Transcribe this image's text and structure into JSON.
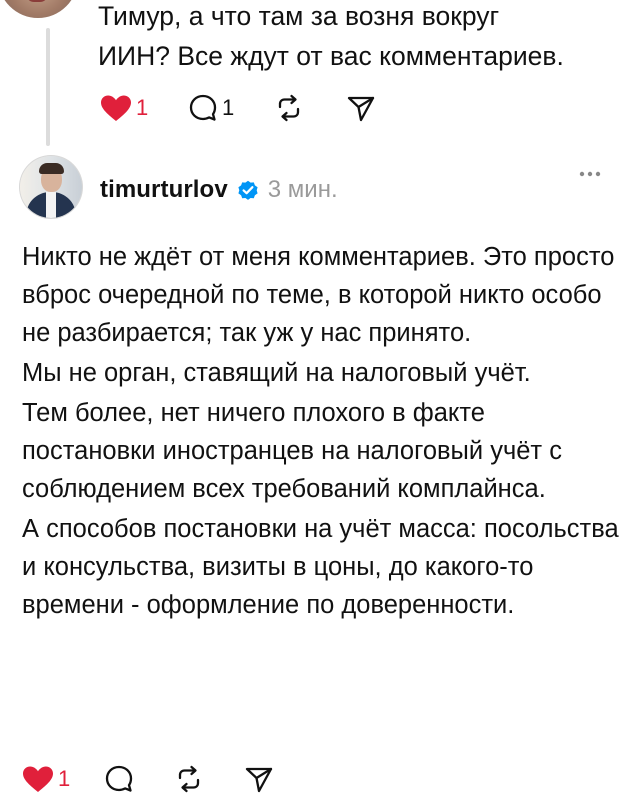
{
  "parent_post": {
    "text": "Тимур, а что там за возня вокруг\nИИН? Все ждут от вас комментариев.",
    "likes": "1",
    "comments": "1"
  },
  "reply_post": {
    "username": "timurturlov",
    "timestamp": "3 мин.",
    "verified": true,
    "paragraphs": [
      "Никто не ждёт от меня комментариев. Это просто вброс очередной по теме, в которой никто особо не разбирается; так уж у нас принято.",
      "Мы не орган, ставящий на налоговый учёт.",
      "Тем более, нет ничего плохого в факте постановки иностранцев на налоговый учёт с соблюдением всех требований комплайнса.",
      "А способов постановки на учёт масса: посольства и консульства, визиты в цоны, до какого-то времени - оформление по доверенности."
    ],
    "likes": "1"
  },
  "icons": {
    "like": "heart-icon",
    "comment": "comment-bubble-icon",
    "repost": "repost-icon",
    "share": "send-icon",
    "more": "ellipsis-icon",
    "verified": "verified-badge-icon"
  },
  "colors": {
    "like_active": "#e0203b",
    "verified": "#0095f6",
    "muted": "#9a9a9a",
    "text": "#111111",
    "thread_line": "#dcdcdc"
  }
}
